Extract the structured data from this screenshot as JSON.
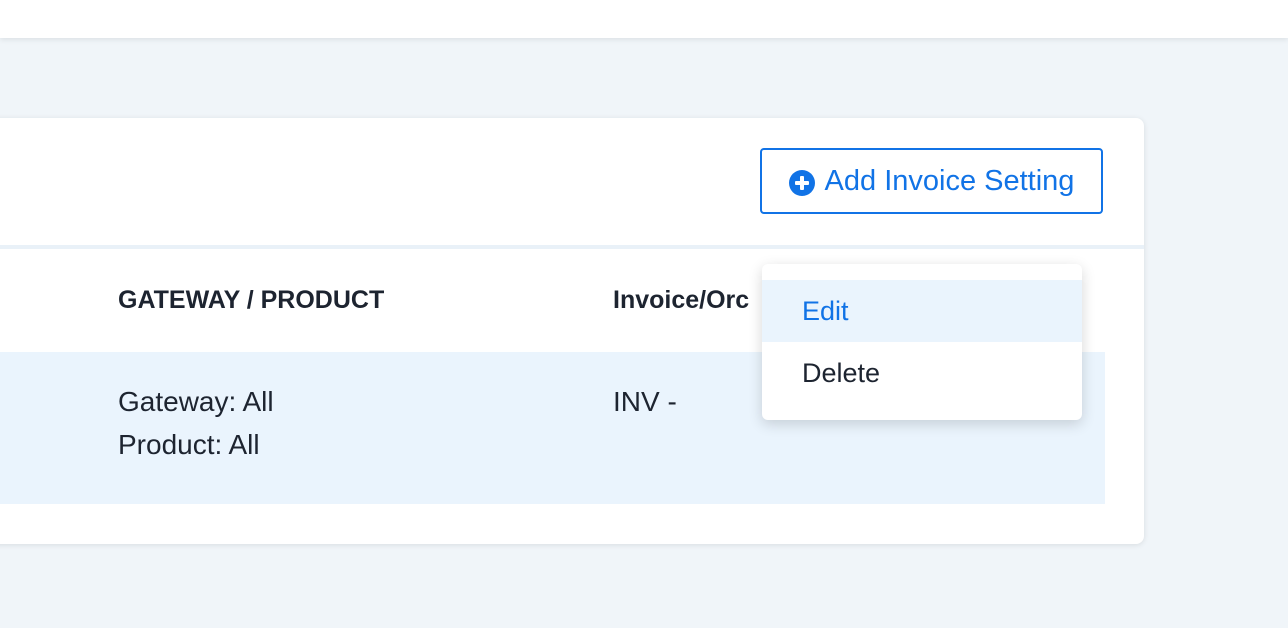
{
  "toolbar": {
    "add_button_label": "Add Invoice Setting",
    "add_icon": "plus-circle-icon"
  },
  "table": {
    "headers": [
      "GATEWAY / PRODUCT",
      "Invoice/Orc"
    ],
    "rows": [
      {
        "gateway": "Gateway: All",
        "product": "Product: All",
        "prefix": "INV -"
      }
    ]
  },
  "context_menu": {
    "items": [
      {
        "label": "Edit",
        "highlighted": true
      },
      {
        "label": "Delete",
        "highlighted": false
      }
    ]
  },
  "colors": {
    "accent": "#1173e6",
    "page_bg": "#f0f5f9",
    "row_highlight": "#eaf4fd",
    "text": "#1d2430"
  }
}
